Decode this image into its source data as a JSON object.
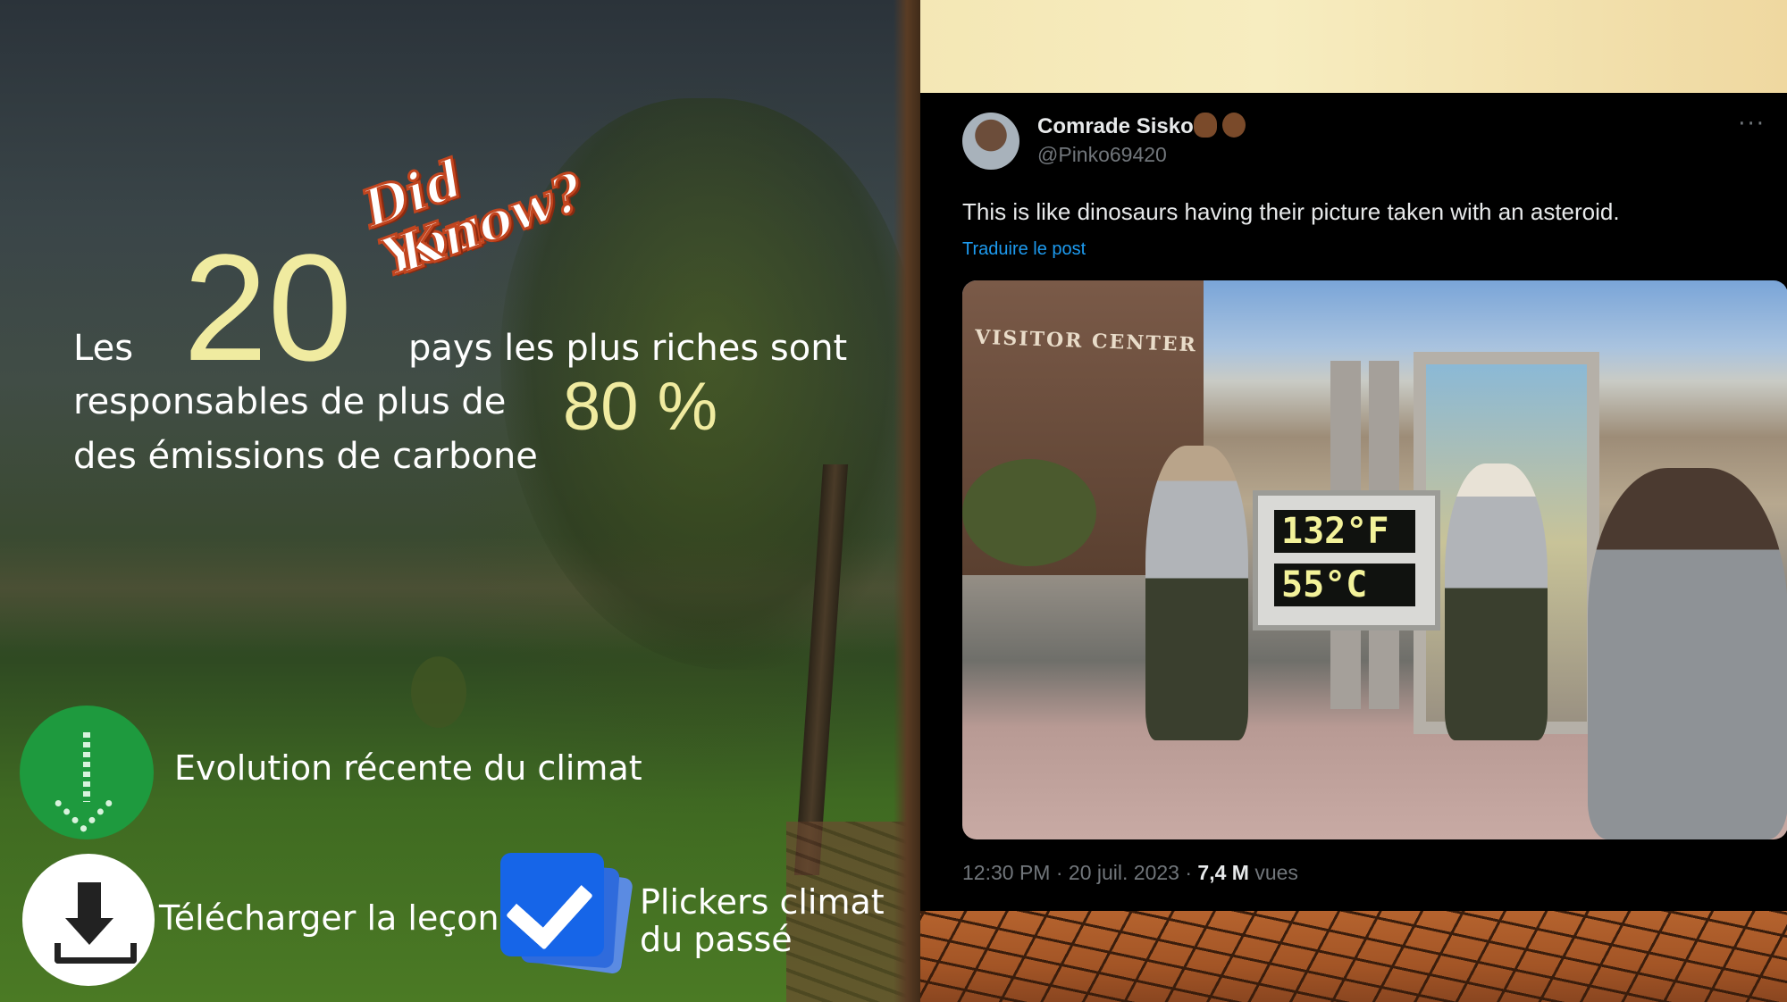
{
  "left_panel": {
    "sticker_line1": "Did You",
    "sticker_line2": "Know?",
    "fact": {
      "prefix": "Les",
      "number": "20",
      "line1_rest": "pays les plus riches sont",
      "line2": "responsables de plus de",
      "percent": "80 %",
      "line3": "des émissions de carbone"
    },
    "links": {
      "climate_evolution": "Evolution récente du climat",
      "download_lesson": "Télécharger la leçon",
      "plickers_line1": "Plickers climat",
      "plickers_line2": "du passé"
    },
    "icons": [
      "dotted-down-arrow-icon",
      "download-icon",
      "checkbox-cards-icon"
    ],
    "colors": {
      "accent_yellow": "#f0eba0",
      "green_button": "#1e9a3e",
      "blue_check": "#1665e8"
    }
  },
  "tweet": {
    "display_name": "Comrade Sisko",
    "handle": "@Pinko69420",
    "more_label": "···",
    "text": "This is like dinosaurs having their picture taken with an asteroid.",
    "translate_label": "Traduire le post",
    "photo": {
      "sign_text": "VISITOR CENTER",
      "reading_f": "132°F",
      "reading_c": "55°C"
    },
    "time": "12:30 PM",
    "sep1": " · ",
    "date": "20 juil. 2023",
    "sep2": " · ",
    "views": "7,4 M",
    "views_label": " vues",
    "colors": {
      "link_blue": "#1d9bf0",
      "muted": "#71767b",
      "text": "#e7e9ea"
    }
  }
}
